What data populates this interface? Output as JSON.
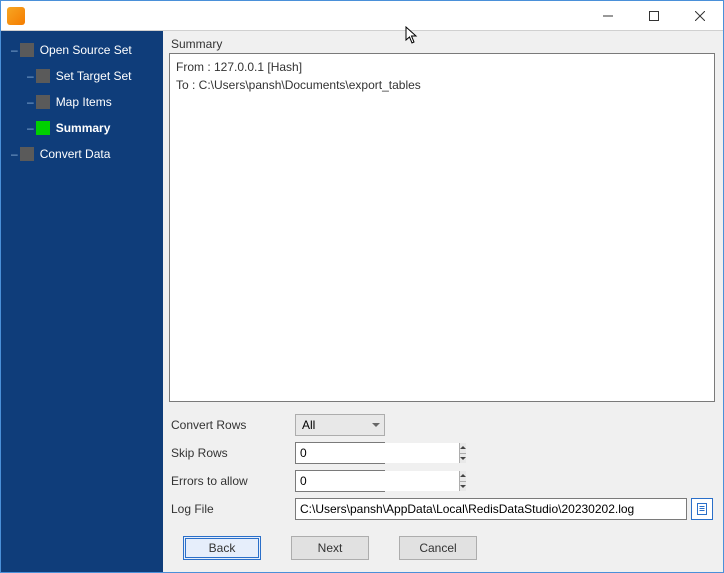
{
  "colors": {
    "sidebar_bg": "#0f3d7a",
    "accent": "#2a6fc9",
    "active_step": "#00d000"
  },
  "sidebar": {
    "items": [
      {
        "label": "Open Source Set",
        "active": false
      },
      {
        "label": "Set Target Set",
        "active": false
      },
      {
        "label": "Map Items",
        "active": false
      },
      {
        "label": "Summary",
        "active": true
      },
      {
        "label": "Convert Data",
        "active": false
      }
    ]
  },
  "summary": {
    "section_label": "Summary",
    "from_line": "From : 127.0.0.1 [Hash]",
    "to_line": "To : C:\\Users\\pansh\\Documents\\export_tables"
  },
  "form": {
    "convert_rows": {
      "label": "Convert Rows",
      "value": "All"
    },
    "skip_rows": {
      "label": "Skip Rows",
      "value": "0"
    },
    "errors": {
      "label": "Errors to allow",
      "value": "0"
    },
    "log_file": {
      "label": "Log File",
      "value": "C:\\Users\\pansh\\AppData\\Local\\RedisDataStudio\\20230202.log"
    }
  },
  "buttons": {
    "back": "Back",
    "next": "Next",
    "cancel": "Cancel"
  }
}
